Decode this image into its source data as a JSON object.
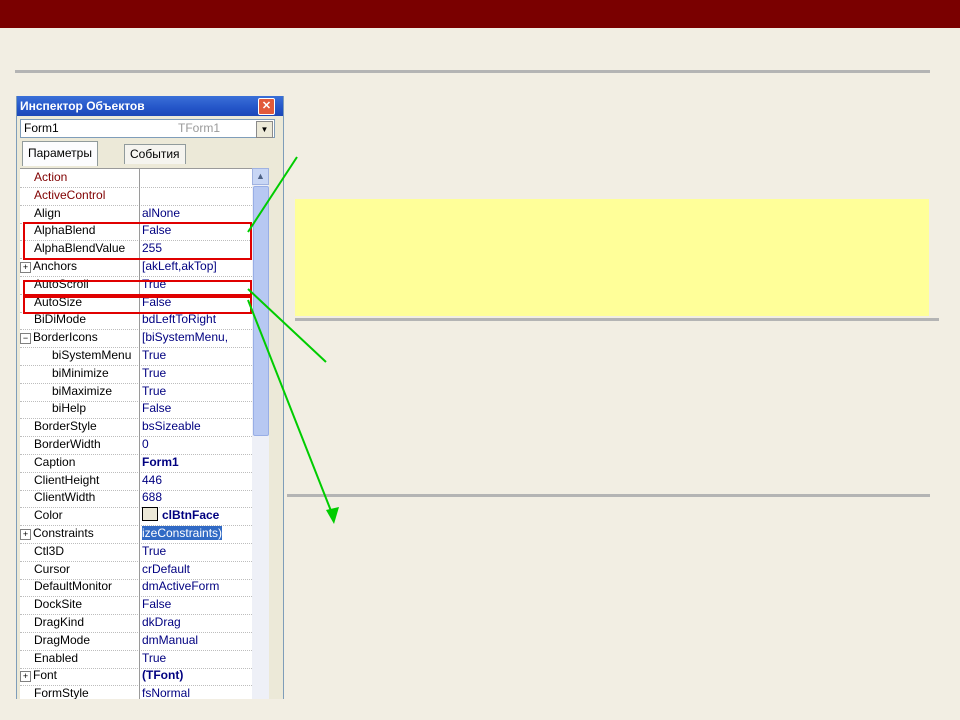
{
  "colors": {
    "top_bar": "#7a0000",
    "background": "#f2eee3",
    "highlight_box": "#ffff99",
    "annotation_red": "#e00000",
    "annotation_arrow": "#00cc00"
  },
  "inspector": {
    "title": "Инспектор Объектов",
    "close_icon": "close-icon",
    "object_selector": {
      "name": "Form1",
      "type": "TForm1",
      "dropdown_icon": "chevron-down-icon"
    },
    "tabs": [
      {
        "label": "Параметры",
        "active": true
      },
      {
        "label": "События",
        "active": false
      }
    ],
    "properties": [
      {
        "name": "Action",
        "value": "",
        "style": "red"
      },
      {
        "name": "ActiveControl",
        "value": "",
        "style": "red"
      },
      {
        "name": "Align",
        "value": "alNone"
      },
      {
        "name": "AlphaBlend",
        "value": "False"
      },
      {
        "name": "AlphaBlendValue",
        "value": "255"
      },
      {
        "name": "Anchors",
        "value": "[akLeft,akTop]",
        "expander": "⊞"
      },
      {
        "name": "AutoScroll",
        "value": "True"
      },
      {
        "name": "AutoSize",
        "value": "False"
      },
      {
        "name": "BiDiMode",
        "value": "bdLeftToRight"
      },
      {
        "name": "BorderIcons",
        "value": "[biSystemMenu,",
        "expander": "⊟"
      },
      {
        "name": "biSystemMenu",
        "value": "True",
        "indent": true
      },
      {
        "name": "biMinimize",
        "value": "True",
        "indent": true
      },
      {
        "name": "biMaximize",
        "value": "True",
        "indent": true
      },
      {
        "name": "biHelp",
        "value": "False",
        "indent": true
      },
      {
        "name": "BorderStyle",
        "value": "bsSizeable"
      },
      {
        "name": "BorderWidth",
        "value": "0"
      },
      {
        "name": "Caption",
        "value": "Form1",
        "bold": true
      },
      {
        "name": "ClientHeight",
        "value": "446"
      },
      {
        "name": "ClientWidth",
        "value": "688"
      },
      {
        "name": "Color",
        "value": "clBtnFace",
        "bold": true,
        "swatch": true
      },
      {
        "name": "Constraints",
        "value": "izeConstraints)",
        "expander": "⊞",
        "selected": true
      },
      {
        "name": "Ctl3D",
        "value": "True"
      },
      {
        "name": "Cursor",
        "value": "crDefault"
      },
      {
        "name": "DefaultMonitor",
        "value": "dmActiveForm"
      },
      {
        "name": "DockSite",
        "value": "False"
      },
      {
        "name": "DragKind",
        "value": "dkDrag"
      },
      {
        "name": "DragMode",
        "value": "dmManual"
      },
      {
        "name": "Enabled",
        "value": "True"
      },
      {
        "name": "Font",
        "value": "(TFont)",
        "bold": true,
        "expander": "⊞"
      },
      {
        "name": "FormStyle",
        "value": "fsNormal"
      }
    ]
  }
}
